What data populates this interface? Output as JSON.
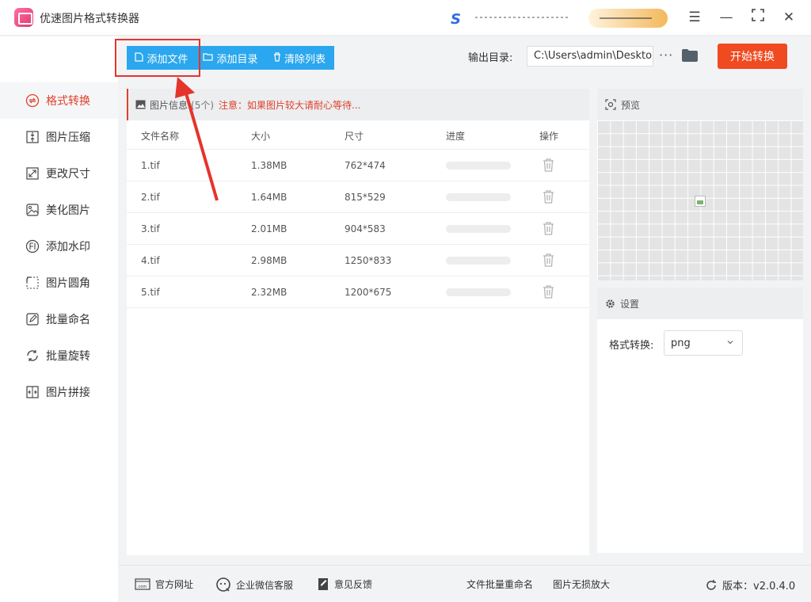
{
  "app": {
    "title": "优速图片格式转换器",
    "version_label": "版本：v2.0.4.0"
  },
  "window_controls": [
    {
      "name": "menu-icon",
      "glyph": "☰"
    },
    {
      "name": "minimize-icon",
      "glyph": "—"
    },
    {
      "name": "maximize-icon",
      "glyph": "⛶"
    },
    {
      "name": "close-icon",
      "glyph": "✕"
    }
  ],
  "sidebar": {
    "items": [
      {
        "label": "格式转换",
        "icon": "format-convert-icon",
        "active": true
      },
      {
        "label": "图片压缩",
        "icon": "compress-icon"
      },
      {
        "label": "更改尺寸",
        "icon": "resize-icon"
      },
      {
        "label": "美化图片",
        "icon": "beautify-icon"
      },
      {
        "label": "添加水印",
        "icon": "watermark-icon"
      },
      {
        "label": "图片圆角",
        "icon": "rounded-corner-icon"
      },
      {
        "label": "批量命名",
        "icon": "rename-icon"
      },
      {
        "label": "批量旋转",
        "icon": "rotate-icon"
      },
      {
        "label": "图片拼接",
        "icon": "stitch-icon"
      }
    ]
  },
  "toolbar": {
    "add_file": "添加文件",
    "add_folder": "添加目录",
    "clear_list": "清除列表",
    "output_label": "输出目录:",
    "output_path": "C:\\Users\\admin\\Desktop",
    "more": "···",
    "start": "开始转换"
  },
  "file_panel": {
    "title": "图片信息",
    "count": "(5个)",
    "note": "注意：如果图片较大请耐心等待...",
    "columns": [
      "文件名称",
      "大小",
      "尺寸",
      "进度",
      "操作"
    ],
    "rows": [
      {
        "name": "1.tif",
        "size": "1.38MB",
        "dims": "762*474",
        "progress": 0
      },
      {
        "name": "2.tif",
        "size": "1.64MB",
        "dims": "815*529",
        "progress": 0
      },
      {
        "name": "3.tif",
        "size": "2.01MB",
        "dims": "904*583",
        "progress": 0
      },
      {
        "name": "4.tif",
        "size": "2.98MB",
        "dims": "1250*833",
        "progress": 0
      },
      {
        "name": "5.tif",
        "size": "2.32MB",
        "dims": "1200*675",
        "progress": 0
      }
    ]
  },
  "preview": {
    "title": "预览"
  },
  "settings": {
    "title": "设置",
    "format_label": "格式转换:",
    "format_value": "png"
  },
  "footer": {
    "website": "官方网址",
    "wechat": "企业微信客服",
    "feedback": "意见反馈",
    "batch_rename": "文件批量重命名",
    "lossless": "图片无损放大"
  },
  "colors": {
    "accent": "#e0402b",
    "primary": "#2aa7ee",
    "start": "#f04a20"
  }
}
